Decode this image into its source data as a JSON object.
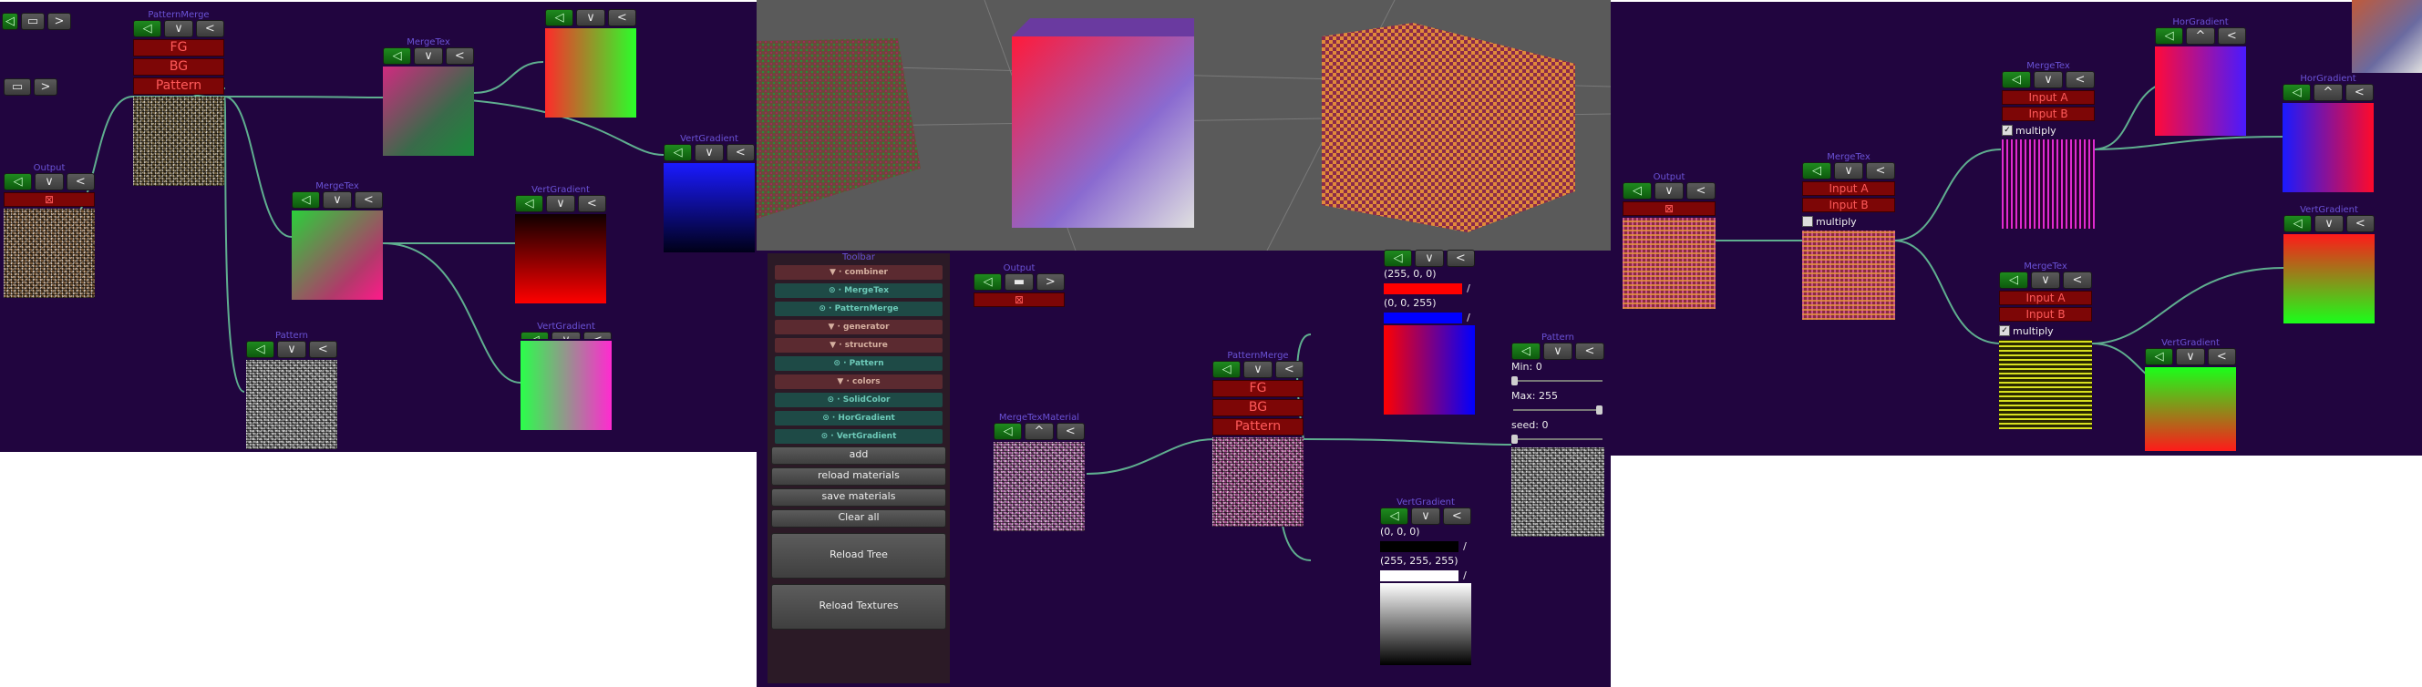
{
  "panel_left": {
    "nodes": {
      "topleft": {
        "buttons": [
          "◁",
          "▭",
          ">"
        ]
      },
      "smallbar": {
        "title": "",
        "buttons": [
          "▭",
          ">"
        ]
      },
      "patternmerge": {
        "title": "PatternMerge",
        "buttons": [
          "◁",
          "∨",
          "<"
        ],
        "fields": [
          "FG",
          "BG",
          "Pattern"
        ]
      },
      "mergetex_top": {
        "title": "MergeTex",
        "buttons": [
          "◁",
          "∨",
          "<"
        ]
      },
      "topgrad": {
        "title": "",
        "buttons": [
          "◁",
          "∨",
          "<"
        ]
      },
      "vertgradient_blue": {
        "title": "VertGradient",
        "buttons": [
          "◁",
          "∨",
          "<"
        ]
      },
      "output": {
        "title": "Output",
        "buttons": [
          "◁",
          "∨",
          "<"
        ],
        "field": "⊠"
      },
      "mergetex_mid": {
        "title": "MergeTex",
        "buttons": [
          "◁",
          "∨",
          "<"
        ]
      },
      "vertgradient_red": {
        "title": "VertGradient",
        "buttons": [
          "◁",
          "∨",
          "<"
        ]
      },
      "pattern": {
        "title": "Pattern",
        "buttons": [
          "◁",
          "∨",
          "<"
        ]
      },
      "vertgradient_pink": {
        "title": "VertGradient",
        "buttons": [
          "◁",
          "∨",
          "<"
        ]
      }
    }
  },
  "sidebar": {
    "title": "Toolbar",
    "items": [
      {
        "label": "▼ · combiner",
        "kind": "header"
      },
      {
        "label": "⊙ · MergeTex",
        "kind": "leaf"
      },
      {
        "label": "⊙ · PatternMerge",
        "kind": "leaf"
      },
      {
        "label": "▼ · generator",
        "kind": "header"
      },
      {
        "label": "▼ · structure",
        "kind": "header"
      },
      {
        "label": "⊙ · Pattern",
        "kind": "leaf"
      },
      {
        "label": "▼ · colors",
        "kind": "header"
      },
      {
        "label": "⊙ · SolidColor",
        "kind": "leaf"
      },
      {
        "label": "⊙ · HorGradient",
        "kind": "leaf"
      },
      {
        "label": "⊙ · VertGradient",
        "kind": "leaf"
      }
    ],
    "buttons": [
      "add",
      "reload materials",
      "save materials",
      "Clear all"
    ],
    "big_buttons": [
      "Reload Tree",
      "Reload Textures"
    ]
  },
  "panel_mid": {
    "nodes": {
      "output": {
        "title": "Output",
        "buttons": [
          "◁",
          "▬",
          ">"
        ],
        "field": "⊠"
      },
      "previewtex": {
        "title": "MergeTexMaterial",
        "buttons": [
          "◁",
          "^",
          "<"
        ]
      },
      "patternmerge": {
        "title": "PatternMerge",
        "buttons": [
          "◁",
          "∨",
          "<"
        ],
        "fields": [
          "FG",
          "BG",
          "Pattern"
        ]
      },
      "horgradient": {
        "title": "",
        "buttons": [
          "◁",
          "∨",
          "<"
        ],
        "color_a": "(255, 0, 0)",
        "color_b": "(0, 0, 255)"
      },
      "vertgradient": {
        "title": "VertGradient",
        "buttons": [
          "◁",
          "∨",
          "<"
        ],
        "color_a": "(0, 0, 0)",
        "color_b": "(255, 255, 255)"
      },
      "pattern": {
        "title": "Pattern",
        "buttons": [
          "◁",
          "∨",
          "<"
        ],
        "min_label": "Min: 0",
        "max_label": "Max: 255",
        "seed_label": "seed: 0",
        "min_value": 0,
        "max_value": 255,
        "seed_value": 0
      }
    }
  },
  "panel_right": {
    "nodes": {
      "output": {
        "title": "Output",
        "buttons": [
          "◁",
          "∨",
          "<"
        ],
        "field": "⊠"
      },
      "mergetex_out": {
        "title": "MergeTex",
        "buttons": [
          "◁",
          "∨",
          "<"
        ],
        "fields": [
          "Input A",
          "Input B"
        ],
        "checkbox": "multiply",
        "checked": false
      },
      "mergetex_top": {
        "title": "MergeTex",
        "buttons": [
          "◁",
          "∨",
          "<"
        ],
        "fields": [
          "Input A",
          "Input B"
        ],
        "checkbox": "multiply",
        "checked": true
      },
      "mergetex_bot": {
        "title": "MergeTex",
        "buttons": [
          "◁",
          "∨",
          "<"
        ],
        "fields": [
          "Input A",
          "Input B"
        ],
        "checkbox": "multiply",
        "checked": true
      },
      "horgradient_a": {
        "title": "HorGradient",
        "buttons": [
          "◁",
          "^",
          "<"
        ]
      },
      "horgradient_b": {
        "title": "HorGradient",
        "buttons": [
          "◁",
          "^",
          "<"
        ]
      },
      "vertgradient_a": {
        "title": "VertGradient",
        "buttons": [
          "◁",
          "∨",
          "<"
        ]
      },
      "vertgradient_b": {
        "title": "VertGradient",
        "buttons": [
          "◁",
          "∨",
          "<"
        ]
      }
    }
  }
}
